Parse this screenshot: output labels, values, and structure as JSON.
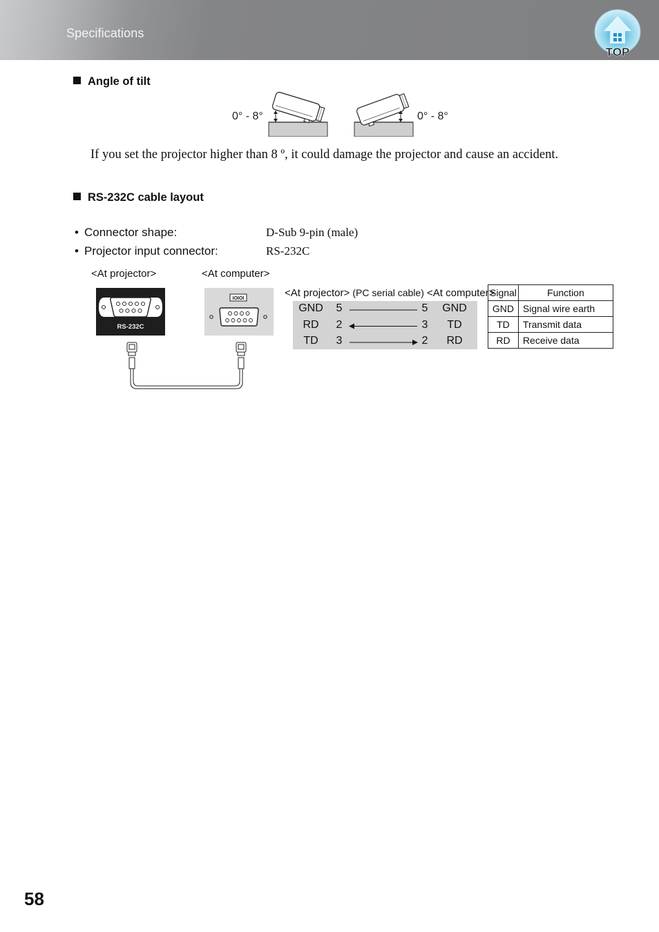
{
  "header": {
    "title": "Specifications",
    "top_button": {
      "label": "TOP",
      "icon": "home-up-arrow-icon"
    }
  },
  "tilt_section": {
    "heading": "Angle of tilt",
    "left_label": "0° - 8°",
    "right_label": "0° - 8°",
    "warning": "If you set the projector higher than 8 º, it could damage the projector and cause an accident."
  },
  "rs232_section": {
    "heading": "RS-232C cable layout",
    "specs": [
      {
        "label": "Connector shape:",
        "value": "D-Sub 9-pin (male)"
      },
      {
        "label": "Projector input connector:",
        "value": "RS-232C"
      }
    ],
    "captions": {
      "at_projector": "<At projector>",
      "at_computer": "<At computer>",
      "pc_serial_cable": "(PC serial cable)"
    },
    "projector_port_label": "RS-232C",
    "computer_port_symbol": "IOIOI",
    "wiring": [
      {
        "proj_signal": "GND",
        "proj_pin": "5",
        "direction": "none",
        "comp_pin": "5",
        "comp_signal": "GND"
      },
      {
        "proj_signal": "RD",
        "proj_pin": "2",
        "direction": "to-projector",
        "comp_pin": "3",
        "comp_signal": "TD"
      },
      {
        "proj_signal": "TD",
        "proj_pin": "3",
        "direction": "to-computer",
        "comp_pin": "2",
        "comp_signal": "RD"
      }
    ],
    "signal_table": {
      "headers": [
        "Signal",
        "Function"
      ],
      "rows": [
        [
          "GND",
          "Signal wire earth"
        ],
        [
          "TD",
          "Transmit data"
        ],
        [
          "RD",
          "Receive data"
        ]
      ]
    }
  },
  "footer": {
    "page_number": "58"
  }
}
